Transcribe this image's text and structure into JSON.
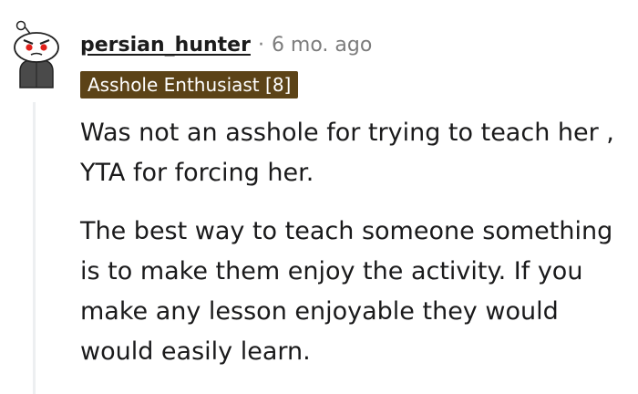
{
  "comment": {
    "author": "persian_hunter",
    "separator": "·",
    "time_ago": "6 mo. ago",
    "flair": "Asshole Enthusiast [8]",
    "avatar_icon": "snoo-avatar-icon",
    "flair_color": "#5c4317",
    "paragraphs": [
      "Was not an asshole for trying to teach her , YTA for forcing her.",
      "The best way to teach someone something is to make them enjoy the activity. If you make any lesson enjoyable they would would easily learn."
    ]
  }
}
